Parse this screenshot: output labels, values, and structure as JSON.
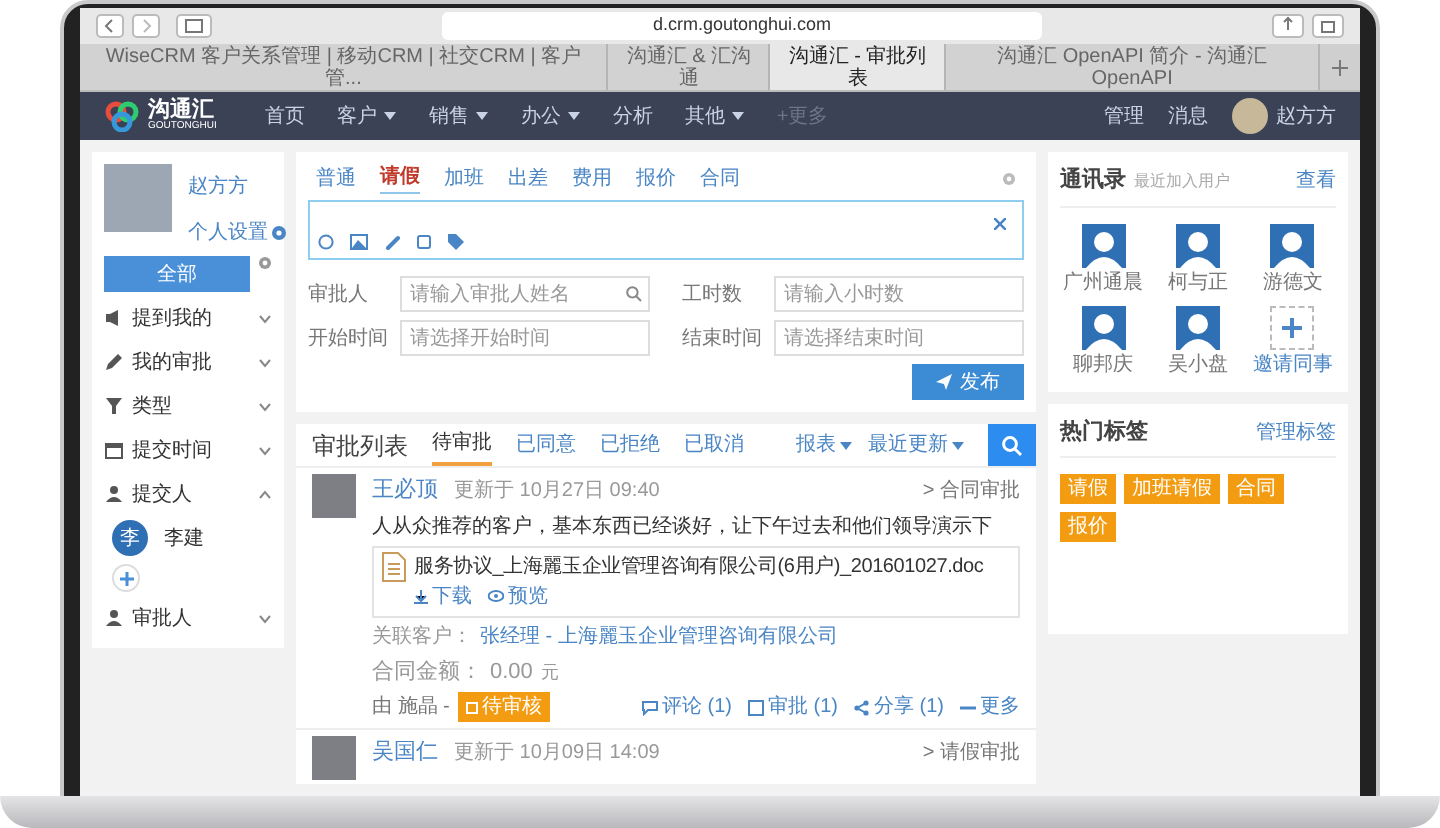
{
  "browser": {
    "url": "d.crm.goutonghui.com",
    "tabs": [
      {
        "label": "WiseCRM 客户关系管理 | 移动CRM | 社交CRM | 客户管...",
        "selected": false
      },
      {
        "label": "沟通汇 & 汇沟通",
        "selected": false
      },
      {
        "label": "沟通汇 - 审批列表",
        "selected": true
      },
      {
        "label": "沟通汇 OpenAPI 简介 - 沟通汇 OpenAPI",
        "selected": false
      }
    ]
  },
  "nav": {
    "logo": "沟通汇",
    "logo_sub": "GOUTONGHUI",
    "items": [
      {
        "label": "首页",
        "dropdown": false
      },
      {
        "label": "客户",
        "dropdown": true
      },
      {
        "label": "销售",
        "dropdown": true
      },
      {
        "label": "办公",
        "dropdown": true
      },
      {
        "label": "分析",
        "dropdown": false
      },
      {
        "label": "其他",
        "dropdown": true
      }
    ],
    "more": "+更多",
    "links": [
      "管理",
      "消息"
    ],
    "user": "赵方方"
  },
  "sidebar": {
    "user_name": "赵方方",
    "settings": "个人设置",
    "all_button": "全部",
    "filters": [
      {
        "kind": "mention",
        "label": "提到我的",
        "expanded": false
      },
      {
        "kind": "pen",
        "label": "我的审批",
        "expanded": false
      },
      {
        "kind": "filter",
        "label": "类型",
        "expanded": false
      },
      {
        "kind": "calendar",
        "label": "提交时间",
        "expanded": false
      },
      {
        "kind": "person",
        "label": "提交人",
        "expanded": true,
        "members": [
          {
            "initial": "李",
            "name": "李建"
          }
        ]
      },
      {
        "kind": "person",
        "label": "审批人",
        "expanded": false
      }
    ]
  },
  "composer": {
    "tabs": [
      {
        "label": "普通",
        "selected": false
      },
      {
        "label": "请假",
        "selected": true
      },
      {
        "label": "加班",
        "selected": false
      },
      {
        "label": "出差",
        "selected": false
      },
      {
        "label": "费用",
        "selected": false
      },
      {
        "label": "报价",
        "selected": false
      },
      {
        "label": "合同",
        "selected": false
      }
    ],
    "fields": [
      {
        "label": "审批人",
        "placeholder": "请输入审批人姓名",
        "kind": "search"
      },
      {
        "label": "工时数",
        "placeholder": "请输入小时数",
        "kind": "text"
      },
      {
        "label": "开始时间",
        "placeholder": "请选择开始时间",
        "kind": "text"
      },
      {
        "label": "结束时间",
        "placeholder": "请选择结束时间",
        "kind": "text"
      }
    ],
    "publish": "发布"
  },
  "approval_list": {
    "title": "审批列表",
    "tabs": [
      {
        "label": "待审批",
        "selected": true
      },
      {
        "label": "已同意",
        "selected": false
      },
      {
        "label": "已拒绝",
        "selected": false
      },
      {
        "label": "已取消",
        "selected": false
      }
    ],
    "sorts": [
      "报表",
      "最近更新"
    ],
    "items": [
      {
        "name": "王必顶",
        "updated": "更新于 10月27日 09:40",
        "type": "> 合同审批",
        "text": "人从众推荐的客户，基本东西已经谈好，让下午过去和他们领导演示下",
        "file": {
          "name": "服务协议_上海麗玉企业管理咨询有限公司(6用户)_201601027.doc",
          "download": "下载",
          "preview": "预览"
        },
        "related_label": "关联客户：",
        "related": "张经理 - 上海麗玉企业管理咨询有限公司",
        "amount_label": "合同金额：",
        "amount": "0.00",
        "unit": "元",
        "by": "由 施晶 -",
        "status": "待审核",
        "actions": [
          "评论 (1)",
          "审批 (1)",
          "分享 (1)",
          "更多"
        ]
      },
      {
        "name": "吴国仁",
        "updated": "更新于 10月09日 14:09",
        "type": "> 请假审批"
      }
    ]
  },
  "contacts": {
    "title": "通讯录",
    "subtitle": "最近加入用户",
    "link": "查看",
    "people": [
      "广州通晨",
      "柯与正",
      "游德文",
      "聊邦庆",
      "吴小盘"
    ],
    "invite": "邀请同事"
  },
  "tags": {
    "title": "热门标签",
    "link": "管理标签",
    "items": [
      "请假",
      "加班请假",
      "合同",
      "报价"
    ]
  }
}
